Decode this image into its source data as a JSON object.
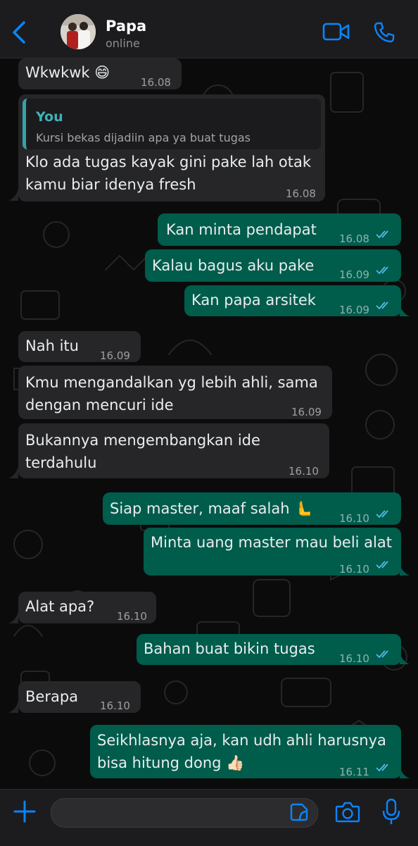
{
  "header": {
    "contact_name": "Papa",
    "status": "online",
    "icons": [
      "back-chevron-icon",
      "video-call-icon",
      "phone-call-icon"
    ]
  },
  "messages": [
    {
      "direction": "in",
      "text": "Wkwkwk 😄",
      "time": "16.08"
    },
    {
      "direction": "in",
      "quote_author": "You",
      "quote_text": "Kursi bekas dijadiin apa ya buat tugas",
      "text_line1": "Klo ada tugas kayak gini pake lah otak",
      "text_line2": "kamu biar idenya fresh",
      "time": "16.08"
    },
    {
      "direction": "out",
      "text": "Kan minta pendapat",
      "time": "16.08",
      "status": "read"
    },
    {
      "direction": "out",
      "text": "Kalau bagus aku pake",
      "time": "16.09",
      "status": "read"
    },
    {
      "direction": "out",
      "text": "Kan papa arsitek",
      "time": "16.09",
      "status": "read"
    },
    {
      "direction": "in",
      "text": "Nah itu",
      "time": "16.09"
    },
    {
      "direction": "in",
      "text_line1": "Kmu mengandalkan yg lebih ahli, sama",
      "text_line2": "dengan mencuri ide",
      "time": "16.09"
    },
    {
      "direction": "in",
      "text_line1": "Bukannya mengembangkan ide",
      "text_line2": "terdahulu",
      "time": "16.10"
    },
    {
      "direction": "out",
      "text": "Siap master, maaf salah 🫷",
      "time": "16.10",
      "status": "read"
    },
    {
      "direction": "out",
      "text": "Minta uang master mau beli alat",
      "time": "16.10",
      "status": "read"
    },
    {
      "direction": "in",
      "text": "Alat apa?",
      "time": "16.10"
    },
    {
      "direction": "out",
      "text": "Bahan buat bikin tugas",
      "time": "16.10",
      "status": "read"
    },
    {
      "direction": "in",
      "text": "Berapa",
      "time": "16.10"
    },
    {
      "direction": "out",
      "text_line1": "Seikhlasnya aja, kan udh ahli harusnya",
      "text_line2": "bisa hitung dong 👍🏻",
      "time": "16.11",
      "status": "read"
    }
  ],
  "footer": {
    "icons": [
      "plus-icon",
      "sticker-icon",
      "camera-icon",
      "microphone-icon"
    ]
  },
  "colors": {
    "accent": "#0a84ff",
    "incoming_bubble": "#262628",
    "outgoing_bubble": "#005c4b",
    "read_ticks": "#53bdeb",
    "quote_accent": "#35a3a8"
  }
}
